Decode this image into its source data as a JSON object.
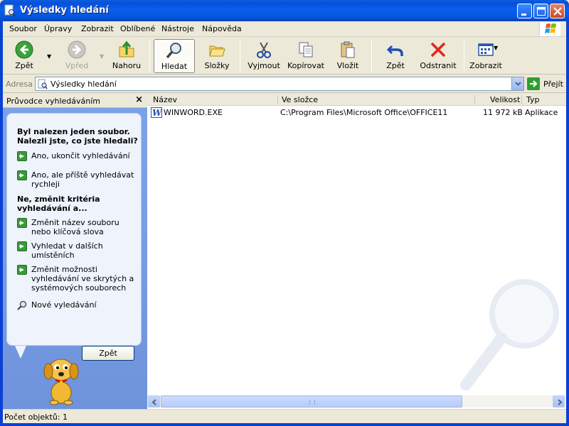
{
  "window": {
    "title": "Výsledky hledání"
  },
  "menu": [
    "Soubor",
    "Úpravy",
    "Zobrazit",
    "Oblíbené",
    "Nástroje",
    "Nápověda"
  ],
  "toolbar": {
    "back": "Zpět",
    "forward": "Vpřed",
    "up": "Nahoru",
    "search": "Hledat",
    "folders": "Složky",
    "cut": "Vyjmout",
    "copy": "Kopírovat",
    "paste": "Vložit",
    "undo": "Zpět",
    "delete": "Odstranit",
    "views": "Zobrazit"
  },
  "address": {
    "label": "Adresa",
    "value": "Výsledky hledání",
    "go": "Přejít"
  },
  "search_pane": {
    "title": "Průvodce vyhledáváním",
    "heading1": "Byl nalezen jeden soubor. Nalezli jste, co jste hledali?",
    "option1": "Ano, ukončit vyhledávání",
    "option2": "Ano, ale příště vyhledávat rychleji",
    "heading2": "Ne, změnit kritéria vyhledávání a...",
    "option3": "Změnit název souboru nebo klíčová slova",
    "option4": "Vyhledat v dalších umístěních",
    "option5": "Změnit možnosti vyhledávání ve skrytých a systémových souborech",
    "new_search": "Nové vyledávání",
    "back_button": "Zpět"
  },
  "list": {
    "columns": [
      "Název",
      "Ve složce",
      "Velikost",
      "Typ"
    ],
    "rows": [
      {
        "name": "WINWORD.EXE",
        "folder": "C:\\Program Files\\Microsoft Office\\OFFICE11",
        "size": "11 972 kB",
        "type": "Aplikace"
      }
    ]
  },
  "status": {
    "text": "Počet objektů: 1"
  }
}
